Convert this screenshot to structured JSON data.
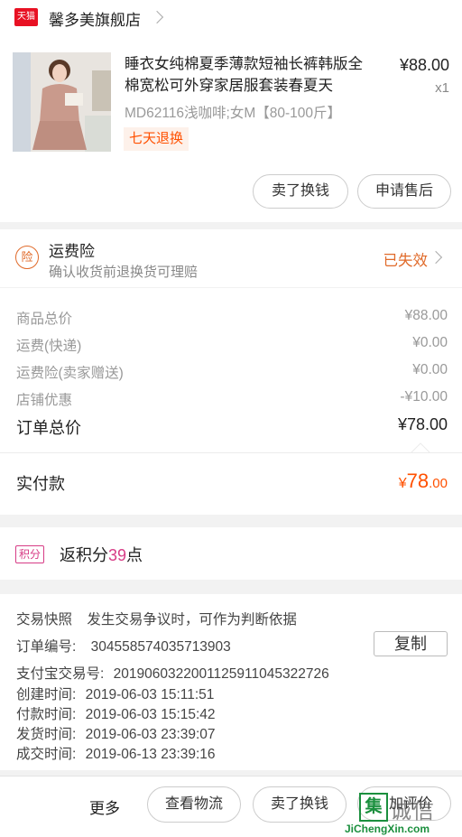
{
  "shop": {
    "badge": "天猫",
    "name": "馨多美旗舰店"
  },
  "product": {
    "title": "睡衣女纯棉夏季薄款短袖长裤韩版全棉宽松可外穿家居服套装春夏天",
    "price": "¥88.00",
    "qty": "x1",
    "sku": "MD62116浅咖啡;女M【80-100斤】",
    "tag": "七天退换",
    "btn_sell": "卖了换钱",
    "btn_aftersale": "申请售后"
  },
  "insurance": {
    "icon_char": "险",
    "title": "运费险",
    "subtitle": "确认收货前退换货可理赔",
    "status": "已失效"
  },
  "breakdown": {
    "rows": [
      {
        "label": "商品总价",
        "value": "¥88.00"
      },
      {
        "label": "运费(快递)",
        "value": "¥0.00"
      },
      {
        "label": "运费险(卖家赠送)",
        "value": "¥0.00"
      },
      {
        "label": "店铺优惠",
        "value": "-¥10.00"
      }
    ],
    "total_label": "订单总价",
    "total_value": "¥78.00"
  },
  "paid": {
    "label": "实付款",
    "currency": "¥",
    "int": "78",
    "dec": ".00"
  },
  "points": {
    "tag": "积分",
    "prefix": "返积分",
    "num": "39",
    "suffix": "点"
  },
  "info": {
    "snapshot_label": "交易快照",
    "snapshot_text": "发生交易争议时，可作为判断依据",
    "order_label": "订单编号:",
    "order_no": "304558574035713903",
    "copy": "复制",
    "alipay_label": "支付宝交易号:",
    "alipay_no": "2019060322001125911045322726",
    "times": [
      {
        "label": "创建时间:",
        "value": "2019-06-03 15:11:51"
      },
      {
        "label": "付款时间:",
        "value": "2019-06-03 15:15:42"
      },
      {
        "label": "发货时间:",
        "value": "2019-06-03 23:39:07"
      },
      {
        "label": "成交时间:",
        "value": "2019-06-13 23:39:16"
      }
    ]
  },
  "bottom": {
    "more": "更多",
    "logistics": "查看物流",
    "sell": "卖了换钱",
    "review_partial": "加评价"
  },
  "watermark": {
    "icon": "集",
    "text": "诚信",
    "url": "JiChengXin.com"
  },
  "colors": {
    "accent": "#ff5000",
    "insurance": "#e06a2a",
    "points": "#d73c86",
    "tmall": "#e81123"
  }
}
